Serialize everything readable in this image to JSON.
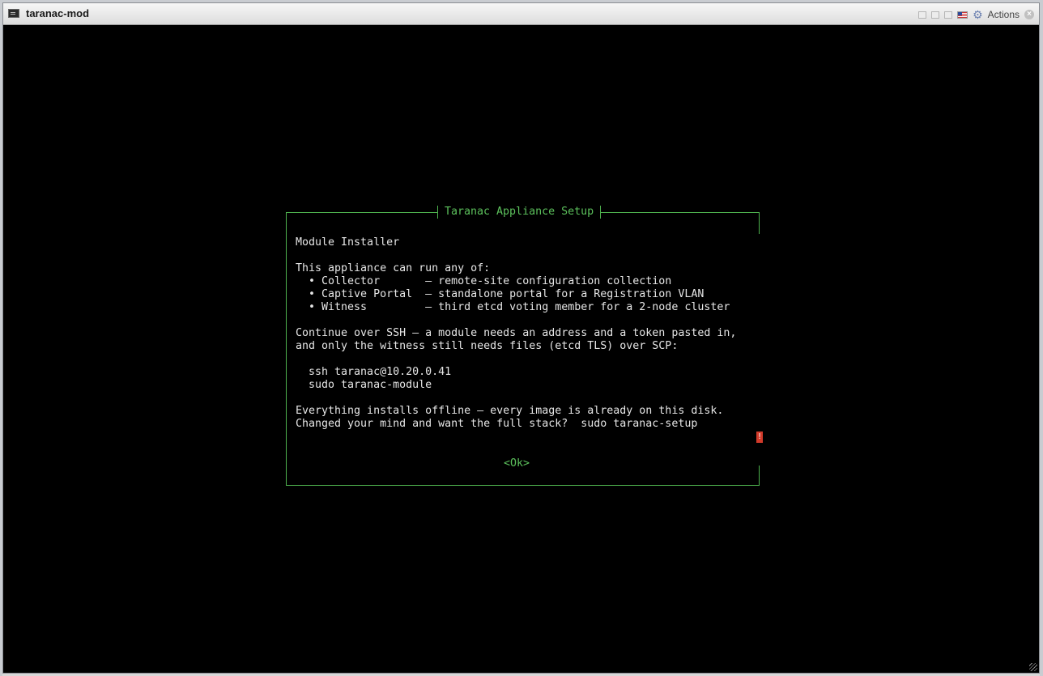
{
  "window": {
    "title": "taranac-mod",
    "actions_label": "Actions",
    "icons": [
      "terminal-icon",
      "gear-icon",
      "flag-icon",
      "close-icon"
    ]
  },
  "dialog": {
    "title": "Taranac Appliance Setup",
    "body": "Module Installer\n\nThis appliance can run any of:\n  • Collector       — remote-site configuration collection\n  • Captive Portal  — standalone portal for a Registration VLAN\n  • Witness         — third etcd voting member for a 2-node cluster\n\nContinue over SSH — a module needs an address and a token pasted in,\nand only the witness still needs files (etcd TLS) over SCP:\n\n  ssh taranac@10.20.0.41\n  sudo taranac-module\n\nEverything installs offline — every image is already on this disk.\nChanged your mind and want the full stack?  sudo taranac-setup",
    "ok_label": "<Ok>",
    "scroll_marker": "!"
  },
  "colors": {
    "terminal_bg": "#000000",
    "dialog_border": "#4eb24e",
    "accent_green": "#5cc15c",
    "text": "#e6e6e6",
    "scroll_marker": "#d23a2a"
  }
}
